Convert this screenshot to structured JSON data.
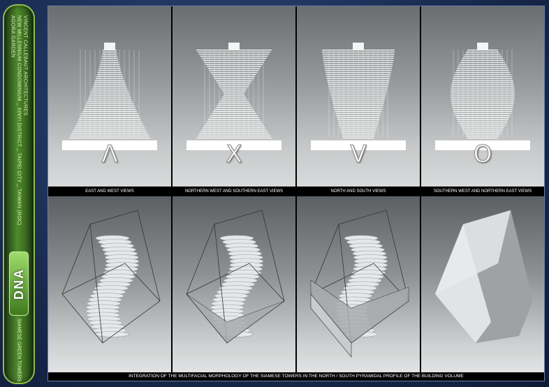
{
  "sidebar": {
    "lines": [
      "VINCENT CALLEBAUT ARCHITECTURES",
      "NEW MILLENNIUM CONDOMINIUM _ XINYI DISTRICT _ TAIPEI CITY _ TAIWAN (ROC)",
      "AGORA GARDEN"
    ],
    "logo": "DNA",
    "subtitle": "SIAMESE GREEN TOWERS"
  },
  "panels": [
    {
      "letter": "Λ",
      "caption": "EAST AND WEST VIEWS",
      "profile": "lambda",
      "volume": "wire"
    },
    {
      "letter": "X",
      "caption": "NORTHERN WEST AND SOUTHERN EAST VIEWS",
      "profile": "x",
      "volume": "base"
    },
    {
      "letter": "V",
      "caption": "NORTH AND SOUTH VIEWS",
      "profile": "v",
      "volume": "half"
    },
    {
      "letter": "O",
      "caption": "SOUTHERN WEST AND NORTHERN EAST VIEWS",
      "profile": "o",
      "volume": "solid"
    }
  ],
  "footer": "INTEGRATION OF THE MULTIFACIAL MORPHOLOGY OF THE SIAMESE TOWERS IN THE NORTH / SOUTH PYRAMIDAL PROFILE OF THE BUILDING VOLUME"
}
